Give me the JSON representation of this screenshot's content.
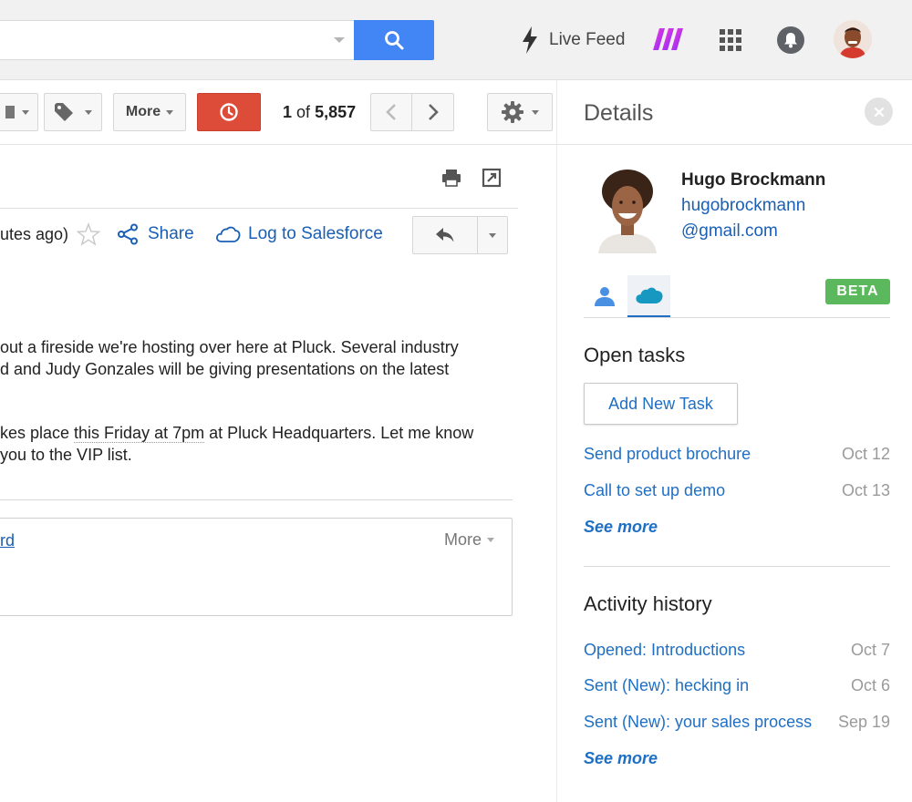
{
  "topbar": {
    "live_feed_label": "Live Feed"
  },
  "toolbar": {
    "more_label": "More",
    "pager": {
      "current": "1",
      "of": "of",
      "total": "5,857"
    }
  },
  "message": {
    "time_fragment": "utes ago)",
    "share_label": "Share",
    "salesforce_label": "Log to Salesforce",
    "body_lines": [
      "out a fireside we're hosting over here at Pluck. Several industry",
      "d and Judy Gonzales will be giving presentations on the latest"
    ],
    "body_line3_pre": "kes place ",
    "body_line3_dotted": "this Friday at 7pm",
    "body_line3_post": " at Pluck Headquarters. Let me know",
    "body_line4": "you to the VIP list.",
    "forward_fragment": "rd",
    "more_label": "More"
  },
  "details": {
    "title": "Details",
    "contact": {
      "name": "Hugo Brockmann",
      "email_line1": "hugobrockmann",
      "email_line2": "@gmail.com"
    },
    "beta_label": "BETA",
    "open_tasks": {
      "title": "Open tasks",
      "add_button": "Add New Task",
      "items": [
        {
          "label": "Send product brochure",
          "date": "Oct 12"
        },
        {
          "label": "Call to set up demo",
          "date": "Oct 13"
        }
      ],
      "see_more": "See more"
    },
    "activity": {
      "title": "Activity history",
      "items": [
        {
          "label": "Opened: Introductions",
          "date": "Oct 7"
        },
        {
          "label": "Sent (New): hecking in",
          "date": "Oct 6"
        },
        {
          "label": "Sent (New): your sales process",
          "date": "Sep 19"
        }
      ],
      "see_more": "See more"
    }
  },
  "icons": {
    "search": "search-icon",
    "bolt": "bolt-icon",
    "apps": "apps-grid-icon",
    "bell": "bell-icon",
    "tag": "tag-icon",
    "clock": "clock-icon",
    "settings": "gear-icon",
    "print": "print-icon",
    "new_window": "new-window-icon",
    "star": "star-icon",
    "share": "share-icon",
    "cloud": "cloud-icon",
    "reply": "reply-icon",
    "person": "person-icon",
    "salesforce": "salesforce-icon"
  },
  "colors": {
    "search_button": "#4285f4",
    "snooze_button": "#dd4b39",
    "link": "#1f6fc4",
    "beta": "#5cb85c",
    "topbar": "#f1f1f1"
  }
}
